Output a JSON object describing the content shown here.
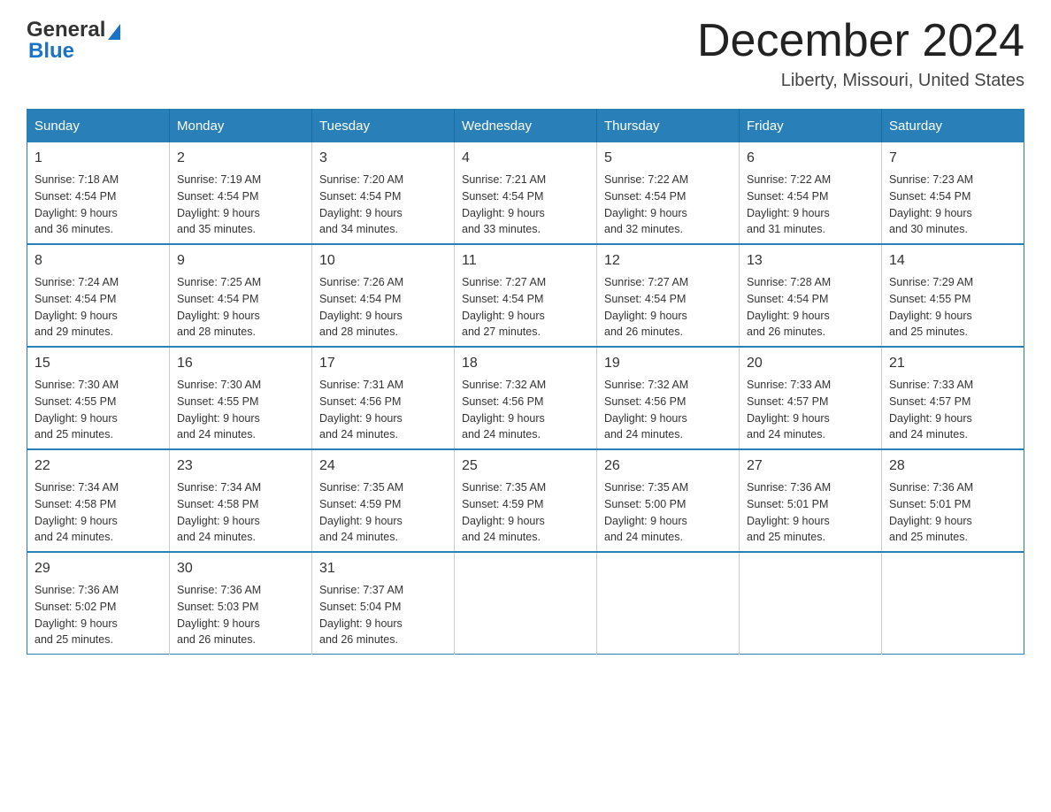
{
  "header": {
    "logo_general": "General",
    "logo_blue": "Blue",
    "month_title": "December 2024",
    "location": "Liberty, Missouri, United States"
  },
  "days_of_week": [
    "Sunday",
    "Monday",
    "Tuesday",
    "Wednesday",
    "Thursday",
    "Friday",
    "Saturday"
  ],
  "weeks": [
    [
      {
        "day": "1",
        "sunrise": "7:18 AM",
        "sunset": "4:54 PM",
        "daylight": "9 hours and 36 minutes."
      },
      {
        "day": "2",
        "sunrise": "7:19 AM",
        "sunset": "4:54 PM",
        "daylight": "9 hours and 35 minutes."
      },
      {
        "day": "3",
        "sunrise": "7:20 AM",
        "sunset": "4:54 PM",
        "daylight": "9 hours and 34 minutes."
      },
      {
        "day": "4",
        "sunrise": "7:21 AM",
        "sunset": "4:54 PM",
        "daylight": "9 hours and 33 minutes."
      },
      {
        "day": "5",
        "sunrise": "7:22 AM",
        "sunset": "4:54 PM",
        "daylight": "9 hours and 32 minutes."
      },
      {
        "day": "6",
        "sunrise": "7:22 AM",
        "sunset": "4:54 PM",
        "daylight": "9 hours and 31 minutes."
      },
      {
        "day": "7",
        "sunrise": "7:23 AM",
        "sunset": "4:54 PM",
        "daylight": "9 hours and 30 minutes."
      }
    ],
    [
      {
        "day": "8",
        "sunrise": "7:24 AM",
        "sunset": "4:54 PM",
        "daylight": "9 hours and 29 minutes."
      },
      {
        "day": "9",
        "sunrise": "7:25 AM",
        "sunset": "4:54 PM",
        "daylight": "9 hours and 28 minutes."
      },
      {
        "day": "10",
        "sunrise": "7:26 AM",
        "sunset": "4:54 PM",
        "daylight": "9 hours and 28 minutes."
      },
      {
        "day": "11",
        "sunrise": "7:27 AM",
        "sunset": "4:54 PM",
        "daylight": "9 hours and 27 minutes."
      },
      {
        "day": "12",
        "sunrise": "7:27 AM",
        "sunset": "4:54 PM",
        "daylight": "9 hours and 26 minutes."
      },
      {
        "day": "13",
        "sunrise": "7:28 AM",
        "sunset": "4:54 PM",
        "daylight": "9 hours and 26 minutes."
      },
      {
        "day": "14",
        "sunrise": "7:29 AM",
        "sunset": "4:55 PM",
        "daylight": "9 hours and 25 minutes."
      }
    ],
    [
      {
        "day": "15",
        "sunrise": "7:30 AM",
        "sunset": "4:55 PM",
        "daylight": "9 hours and 25 minutes."
      },
      {
        "day": "16",
        "sunrise": "7:30 AM",
        "sunset": "4:55 PM",
        "daylight": "9 hours and 24 minutes."
      },
      {
        "day": "17",
        "sunrise": "7:31 AM",
        "sunset": "4:56 PM",
        "daylight": "9 hours and 24 minutes."
      },
      {
        "day": "18",
        "sunrise": "7:32 AM",
        "sunset": "4:56 PM",
        "daylight": "9 hours and 24 minutes."
      },
      {
        "day": "19",
        "sunrise": "7:32 AM",
        "sunset": "4:56 PM",
        "daylight": "9 hours and 24 minutes."
      },
      {
        "day": "20",
        "sunrise": "7:33 AM",
        "sunset": "4:57 PM",
        "daylight": "9 hours and 24 minutes."
      },
      {
        "day": "21",
        "sunrise": "7:33 AM",
        "sunset": "4:57 PM",
        "daylight": "9 hours and 24 minutes."
      }
    ],
    [
      {
        "day": "22",
        "sunrise": "7:34 AM",
        "sunset": "4:58 PM",
        "daylight": "9 hours and 24 minutes."
      },
      {
        "day": "23",
        "sunrise": "7:34 AM",
        "sunset": "4:58 PM",
        "daylight": "9 hours and 24 minutes."
      },
      {
        "day": "24",
        "sunrise": "7:35 AM",
        "sunset": "4:59 PM",
        "daylight": "9 hours and 24 minutes."
      },
      {
        "day": "25",
        "sunrise": "7:35 AM",
        "sunset": "4:59 PM",
        "daylight": "9 hours and 24 minutes."
      },
      {
        "day": "26",
        "sunrise": "7:35 AM",
        "sunset": "5:00 PM",
        "daylight": "9 hours and 24 minutes."
      },
      {
        "day": "27",
        "sunrise": "7:36 AM",
        "sunset": "5:01 PM",
        "daylight": "9 hours and 25 minutes."
      },
      {
        "day": "28",
        "sunrise": "7:36 AM",
        "sunset": "5:01 PM",
        "daylight": "9 hours and 25 minutes."
      }
    ],
    [
      {
        "day": "29",
        "sunrise": "7:36 AM",
        "sunset": "5:02 PM",
        "daylight": "9 hours and 25 minutes."
      },
      {
        "day": "30",
        "sunrise": "7:36 AM",
        "sunset": "5:03 PM",
        "daylight": "9 hours and 26 minutes."
      },
      {
        "day": "31",
        "sunrise": "7:37 AM",
        "sunset": "5:04 PM",
        "daylight": "9 hours and 26 minutes."
      },
      null,
      null,
      null,
      null
    ]
  ],
  "labels": {
    "sunrise": "Sunrise: ",
    "sunset": "Sunset: ",
    "daylight": "Daylight: "
  }
}
